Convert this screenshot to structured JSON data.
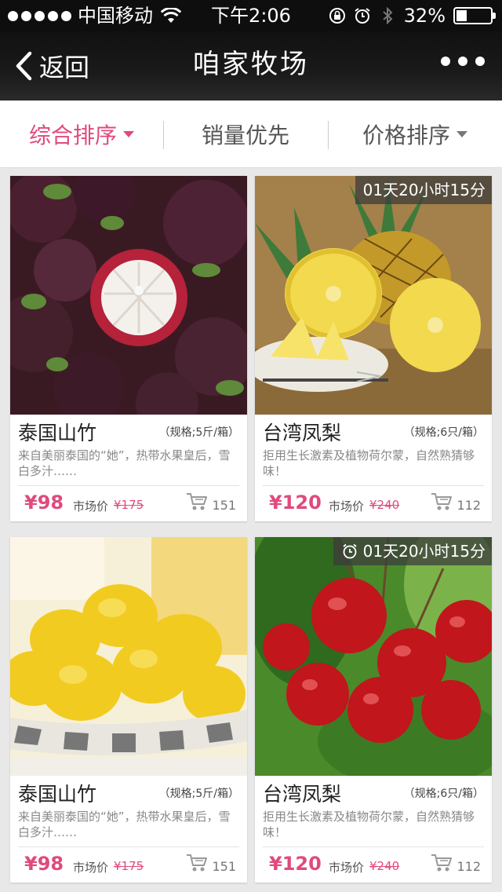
{
  "status_bar": {
    "carrier": "中国移动",
    "time": "下午2:06",
    "battery": "32%",
    "battery_level": 0.32,
    "signal_bars": 5
  },
  "nav": {
    "back_label": "返回",
    "title": "咱家牧场"
  },
  "sort_tabs": [
    {
      "label": "综合排序",
      "active": true
    },
    {
      "label": "销量优先",
      "active": false
    },
    {
      "label": "价格排序",
      "active": false
    }
  ],
  "products": [
    {
      "name": "泰国山竹",
      "spec": "（规格;5斤/箱）",
      "desc": "来自美丽泰国的“她”，热带水果皇后，雪白多汁……",
      "price": "¥98",
      "market_label": "市场价",
      "market_price": "¥175",
      "sales": "151",
      "countdown": null,
      "image": "mangosteen"
    },
    {
      "name": "台湾凤梨",
      "spec": "（规格;6只/箱）",
      "desc": "拒用生长激素及植物荷尔蒙，自然熟猜够味！",
      "price": "¥120",
      "market_label": "市场价",
      "market_price": "¥240",
      "sales": "112",
      "countdown": "01天20小时15分",
      "image": "pineapple"
    },
    {
      "name": "泰国山竹",
      "spec": "（规格;5斤/箱）",
      "desc": "来自美丽泰国的“她”，热带水果皇后，雪白多汁……",
      "price": "¥98",
      "market_label": "市场价",
      "market_price": "¥175",
      "sales": "151",
      "countdown": null,
      "image": "lemon"
    },
    {
      "name": "台湾凤梨",
      "spec": "（规格;6只/箱）",
      "desc": "拒用生长激素及植物荷尔蒙，自然熟猜够味！",
      "price": "¥120",
      "market_label": "市场价",
      "market_price": "¥240",
      "sales": "112",
      "countdown": "01天20小时15分",
      "image": "cherry"
    }
  ],
  "icons": {
    "back": "chevron-left-icon",
    "more": "more-dots-icon",
    "cart": "cart-icon",
    "alarm": "alarm-clock-icon",
    "wifi": "wifi-icon",
    "lock": "rotation-lock-icon",
    "bluetooth": "bluetooth-icon"
  },
  "colors": {
    "accent": "#e04a7c",
    "nav_bg": "#151515",
    "page_bg": "#e8e8e8"
  }
}
